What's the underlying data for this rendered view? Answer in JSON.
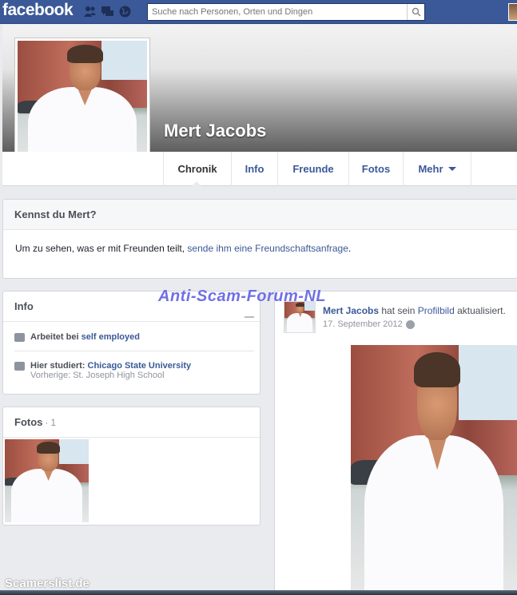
{
  "topbar": {
    "logo": "facebook",
    "search_placeholder": "Suche nach Personen, Orten und Dingen",
    "icons": [
      "friends-icon",
      "messages-icon",
      "notifications-globe-icon",
      "search-icon"
    ]
  },
  "profile": {
    "name": "Mert Jacobs"
  },
  "nav": {
    "tabs": [
      {
        "label": "Chronik",
        "active": true
      },
      {
        "label": "Info"
      },
      {
        "label": "Freunde"
      },
      {
        "label": "Fotos"
      },
      {
        "label": "Mehr"
      }
    ]
  },
  "friend_request": {
    "title": "Kennst du Mert?",
    "text_prefix": "Um zu sehen, was er mit Freunden teilt, ",
    "link": "sende ihm eine Freundschaftsanfrage",
    "text_suffix": "."
  },
  "info": {
    "title": "Info",
    "work_prefix": "Arbeitet bei ",
    "work_link": "self employed",
    "edu_prefix": "Hier studiert: ",
    "edu_link": "Chicago State University",
    "edu_previous": "Vorherige: St. Joseph High School"
  },
  "fotos": {
    "title": "Fotos",
    "separator": " · ",
    "count": "1"
  },
  "post": {
    "name": "Mert Jacobs",
    "action_1": " hat sein ",
    "action_link": "Profilbild",
    "action_2": " aktualisiert.",
    "date": "17. September 2012"
  },
  "watermarks": {
    "center": "Anti-Scam-Forum-NL",
    "footer": "Scamerslist.de"
  },
  "colors": {
    "brand": "#3b5998",
    "background": "#e9ebee"
  }
}
